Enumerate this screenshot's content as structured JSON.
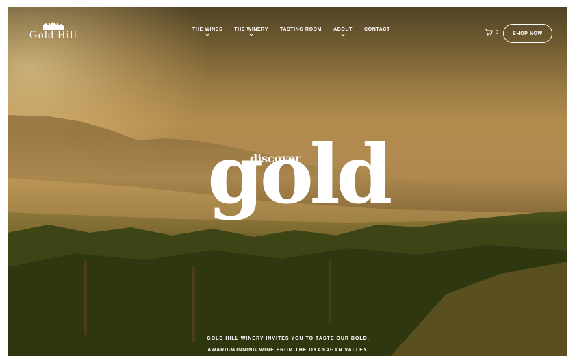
{
  "brand": {
    "name": "Gold Hill",
    "logo_icon": "winery-house-icon"
  },
  "nav": {
    "items": [
      {
        "label": "THE WINES",
        "has_dropdown": true
      },
      {
        "label": "THE WINERY",
        "has_dropdown": true
      },
      {
        "label": "TASTING ROOM",
        "has_dropdown": false
      },
      {
        "label": "ABOUT",
        "has_dropdown": true
      },
      {
        "label": "CONTACT",
        "has_dropdown": false
      }
    ]
  },
  "cart": {
    "icon": "cart-icon",
    "count": "0"
  },
  "shop_button": {
    "label": "SHOP NOW"
  },
  "hero": {
    "small": "discover",
    "big": "gold",
    "tagline_line1": "GOLD HILL WINERY INVITES YOU TO TASTE OUR BOLD,",
    "tagline_line2": "AWARD-WINNING WINE FROM THE OKANAGAN VALLEY."
  },
  "colors": {
    "text": "#ffffff",
    "sky": "#b38d4f",
    "vineyard": "#3a3e16"
  }
}
